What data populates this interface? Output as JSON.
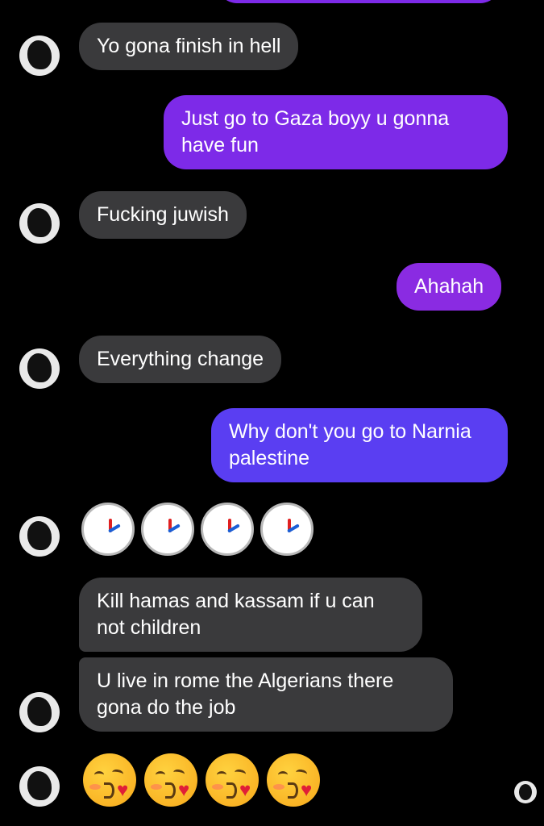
{
  "messages": [
    {
      "text": "Yo gona finish in hell"
    },
    {
      "text": "Just go to Gaza boyy u gonna\nhave fun"
    },
    {
      "text": "Fucking juwish"
    },
    {
      "text": "Ahahah"
    },
    {
      "text": "Everything change"
    },
    {
      "text": "Why don't you go to Narnia\npalestine"
    },
    {
      "emoji_icons": [
        "two-oclock-icon",
        "two-oclock-icon",
        "two-oclock-icon",
        "two-oclock-icon"
      ]
    },
    {
      "text": "Kill hamas and kassam  if u can\nnot children"
    },
    {
      "text": "U live in rome the Algerians there\ngona do the job"
    },
    {
      "emoji_icons": [
        "kissing-face-heart-icon",
        "kissing-face-heart-icon",
        "kissing-face-heart-icon",
        "kissing-face-heart-icon"
      ]
    }
  ],
  "colors": {
    "background": "#000000",
    "received_bubble": "#3a3a3c",
    "sent_bubble_top": "#7d2ae8",
    "sent_bubble_bottom": "#5a3ef2",
    "text": "#ffffff"
  }
}
